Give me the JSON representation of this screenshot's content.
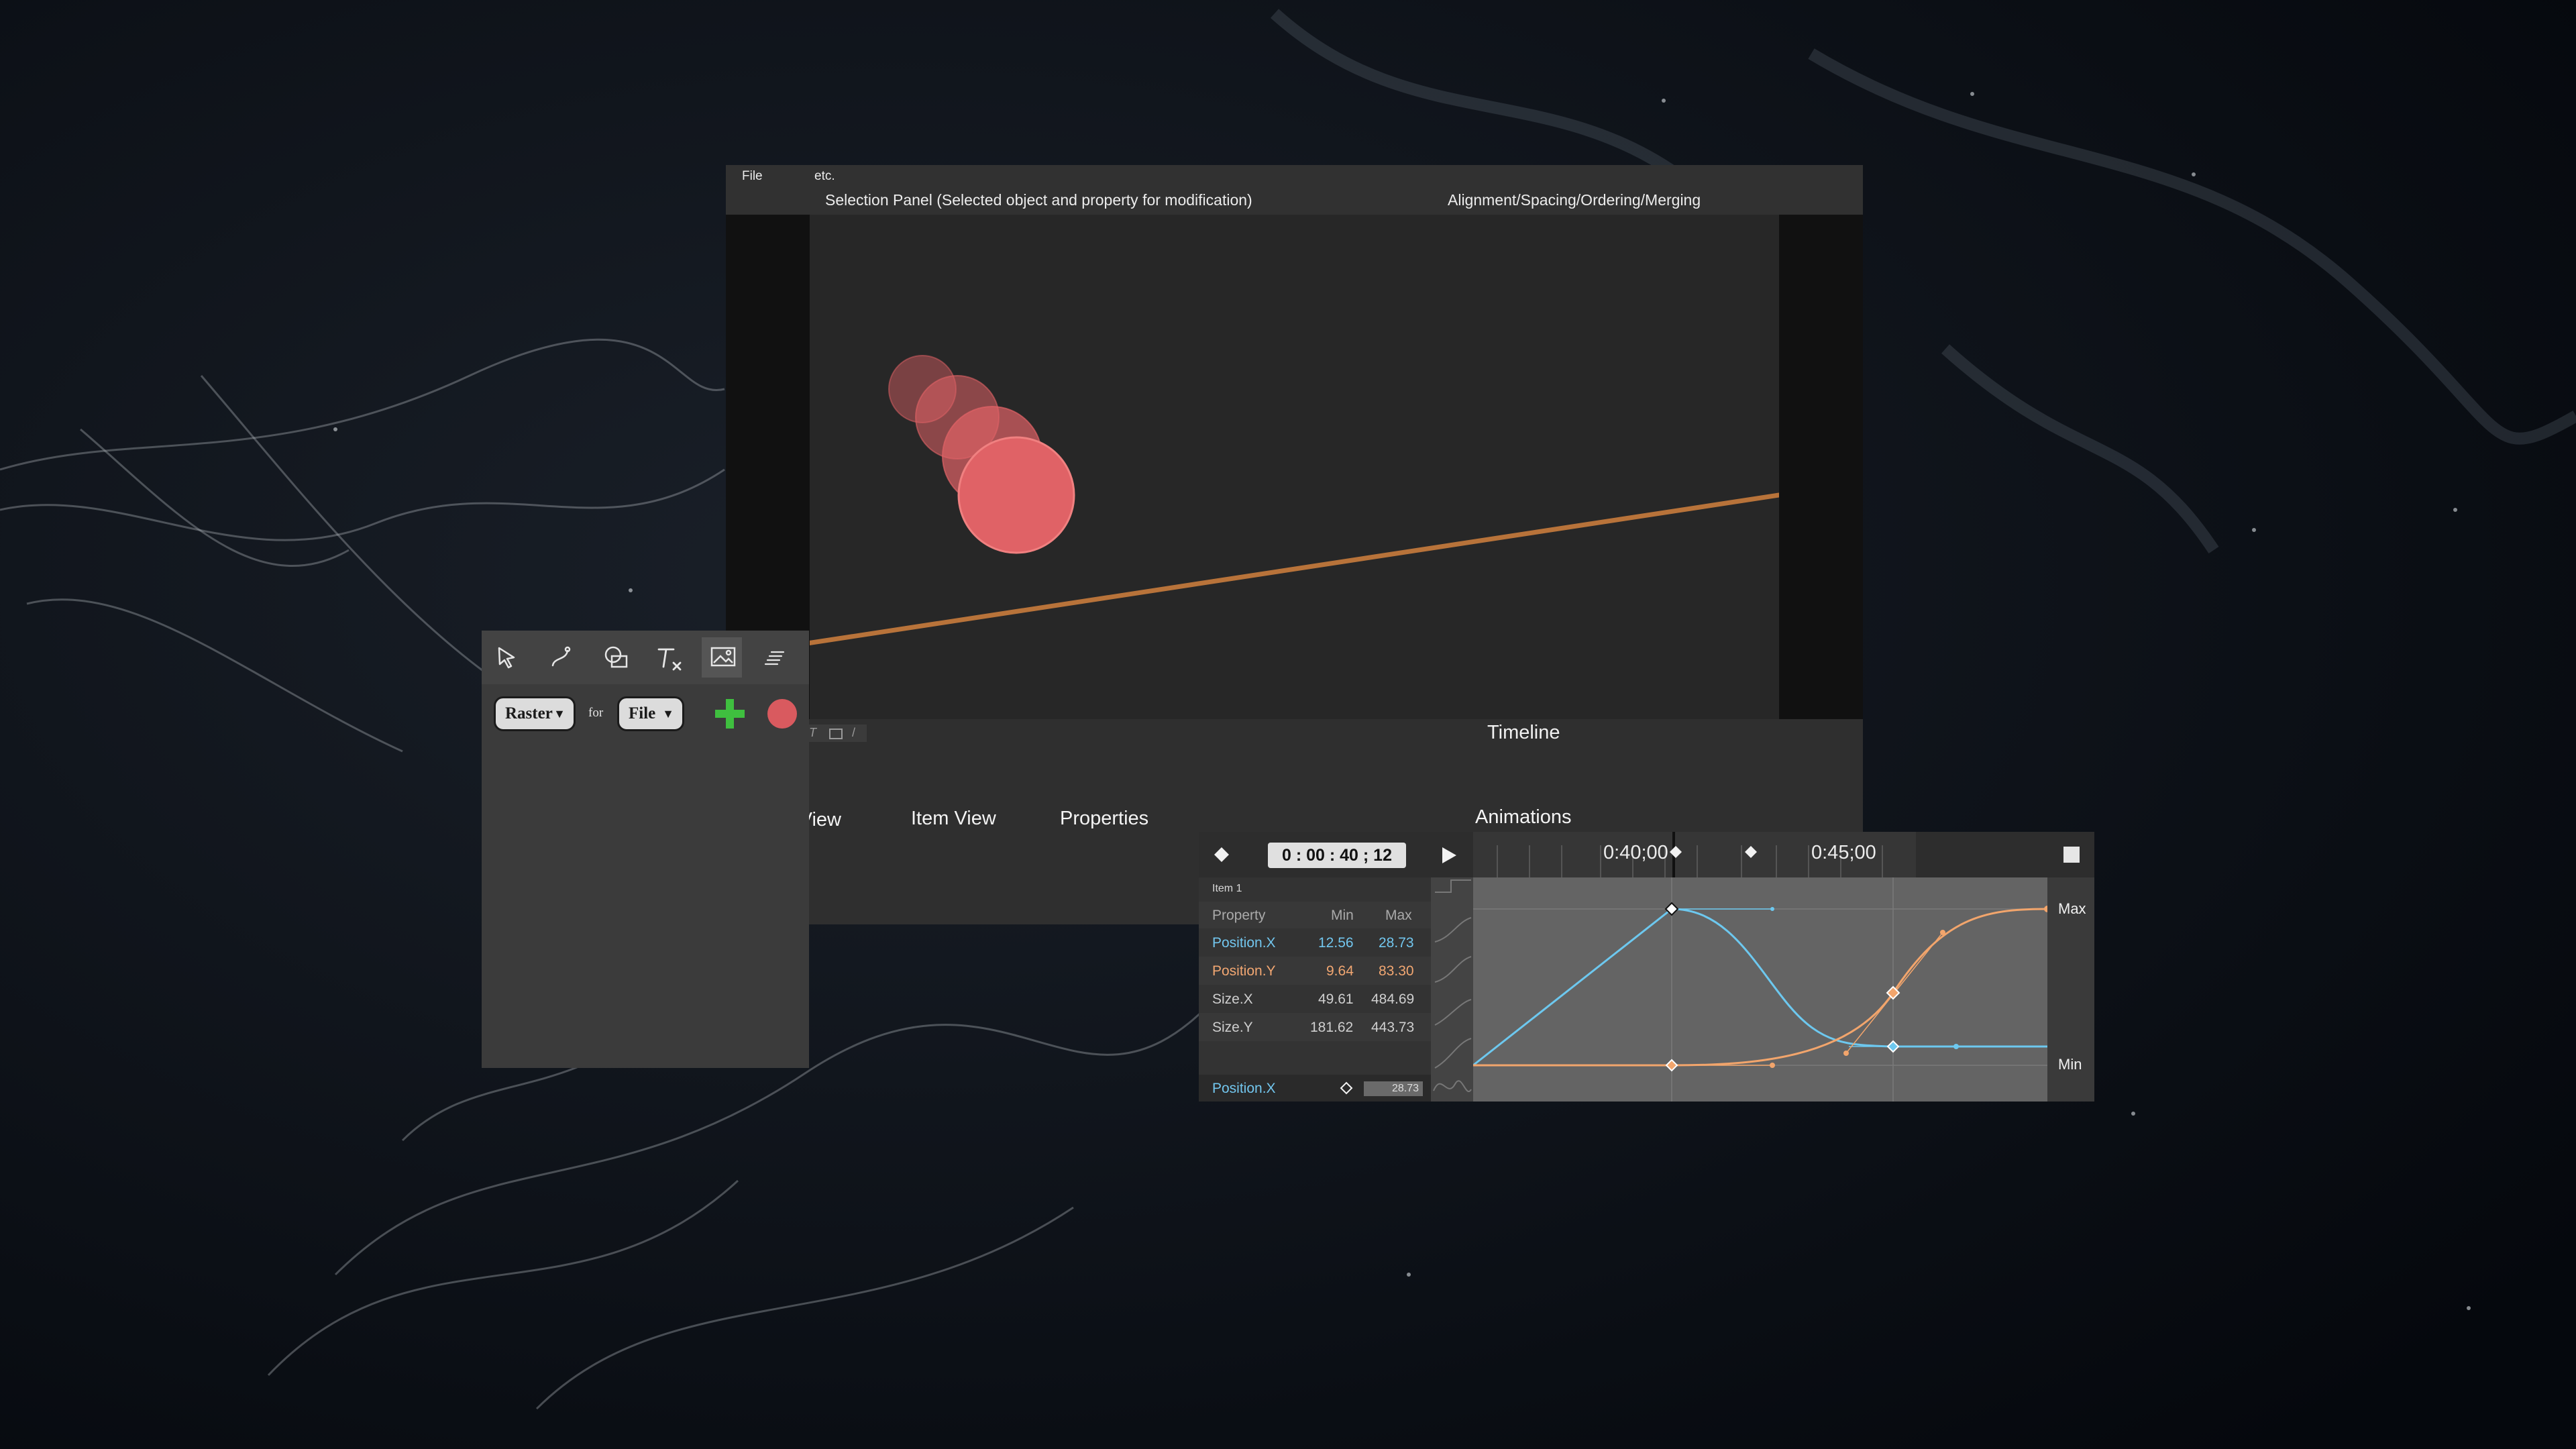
{
  "menu": {
    "file": "File",
    "etc": "etc."
  },
  "panels": {
    "selection": "Selection Panel (Selected object and property for modification)",
    "alignment": "Alignment/Spacing/Ordering/Merging"
  },
  "bottom": {
    "timeline_title": "Timeline",
    "tabs": [
      "View",
      "Item View",
      "Properties",
      "Animations"
    ]
  },
  "toolbox": {
    "tools": [
      "select-arrow-icon",
      "path-pen-icon",
      "shapes-icon",
      "text-clear-icon",
      "image-icon",
      "align-lines-icon"
    ],
    "raster_label": "Raster",
    "for_label": "for",
    "file_label": "File",
    "add_color": "#3fbf3f",
    "record_color": "#d95a5f"
  },
  "timeline": {
    "current_time": "0 : 00 : 40 ; 12",
    "marker_left": "0:40;00",
    "marker_right": "0:45;00",
    "item_label": "Item 1",
    "headers": {
      "property": "Property",
      "min": "Min",
      "max": "Max"
    },
    "rows": [
      {
        "name": "Position.X",
        "min": "12.56",
        "max": "28.73",
        "color": "#72c6ee"
      },
      {
        "name": "Position.Y",
        "min": "9.64",
        "max": "83.30",
        "color": "#f2a772"
      },
      {
        "name": "Size.X",
        "min": "49.61",
        "max": "484.69",
        "color": "#cfcfcf"
      },
      {
        "name": "Size.Y",
        "min": "181.62",
        "max": "443.73",
        "color": "#cfcfcf"
      }
    ],
    "selected": {
      "name": "Position.X",
      "value": "28.73"
    },
    "axis_max": "Max",
    "axis_min": "Min",
    "curve_colors": {
      "x": "#6dc8ef",
      "y": "#f2a56c"
    }
  },
  "colors": {
    "circle": "#e06266",
    "motion_path": "#b8733a"
  }
}
